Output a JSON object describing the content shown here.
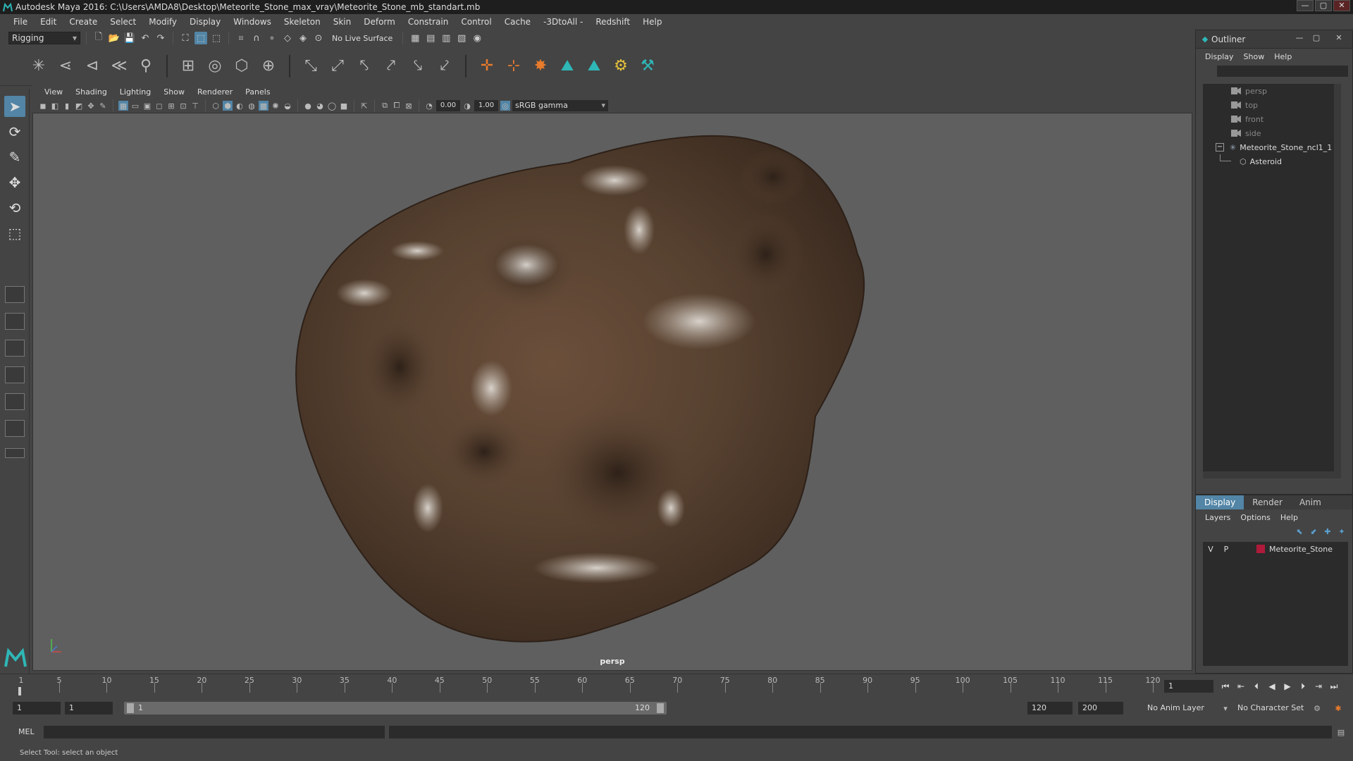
{
  "window": {
    "title": "Autodesk Maya 2016: C:\\Users\\AMDA8\\Desktop\\Meteorite_Stone_max_vray\\Meteorite_Stone_mb_standart.mb"
  },
  "menubar": [
    "File",
    "Edit",
    "Create",
    "Select",
    "Modify",
    "Display",
    "Windows",
    "Skeleton",
    "Skin",
    "Deform",
    "Constrain",
    "Control",
    "Cache",
    "-3DtoAll -",
    "Redshift",
    "Help"
  ],
  "statusline": {
    "mode": "Rigging",
    "live_surface": "No Live Surface"
  },
  "panel": {
    "menus": [
      "View",
      "Shading",
      "Lighting",
      "Show",
      "Renderer",
      "Panels"
    ],
    "exposure": "0.00",
    "gamma": "1.00",
    "color_space": "sRGB gamma",
    "camera_label": "persp"
  },
  "outliner": {
    "title": "Outliner",
    "menus": [
      "Display",
      "Show",
      "Help"
    ],
    "items": [
      {
        "label": "persp",
        "type": "camera"
      },
      {
        "label": "top",
        "type": "camera"
      },
      {
        "label": "front",
        "type": "camera"
      },
      {
        "label": "side",
        "type": "camera"
      },
      {
        "label": "Meteorite_Stone_ncl1_1",
        "type": "group"
      },
      {
        "label": "Asteroid",
        "type": "mesh"
      }
    ]
  },
  "layers": {
    "tabs": [
      "Display",
      "Render",
      "Anim"
    ],
    "active_tab": "Display",
    "menus": [
      "Layers",
      "Options",
      "Help"
    ],
    "rows": [
      {
        "v": "V",
        "p": "P",
        "name": "Meteorite_Stone",
        "color": "#b01a3a"
      }
    ]
  },
  "timeline": {
    "ticks": [
      "5",
      "10",
      "15",
      "20",
      "25",
      "30",
      "35",
      "40",
      "45",
      "50",
      "55",
      "60",
      "65",
      "70",
      "75",
      "80",
      "85",
      "90",
      "95",
      "100",
      "105",
      "110",
      "115",
      "120"
    ],
    "start_tick": "1",
    "current_frame": "1"
  },
  "range": {
    "start": "1",
    "playback_start": "1",
    "range_start_label": "1",
    "range_end_label": "120",
    "playback_end": "120",
    "end": "200",
    "anim_layer": "No Anim Layer",
    "character_set": "No Character Set"
  },
  "command": {
    "language": "MEL"
  },
  "help_line": "Select Tool: select an object",
  "colors": {
    "accent": "#5285a6",
    "viewport_bg": "#5f5f5f",
    "layer_color": "#b01a3a"
  }
}
